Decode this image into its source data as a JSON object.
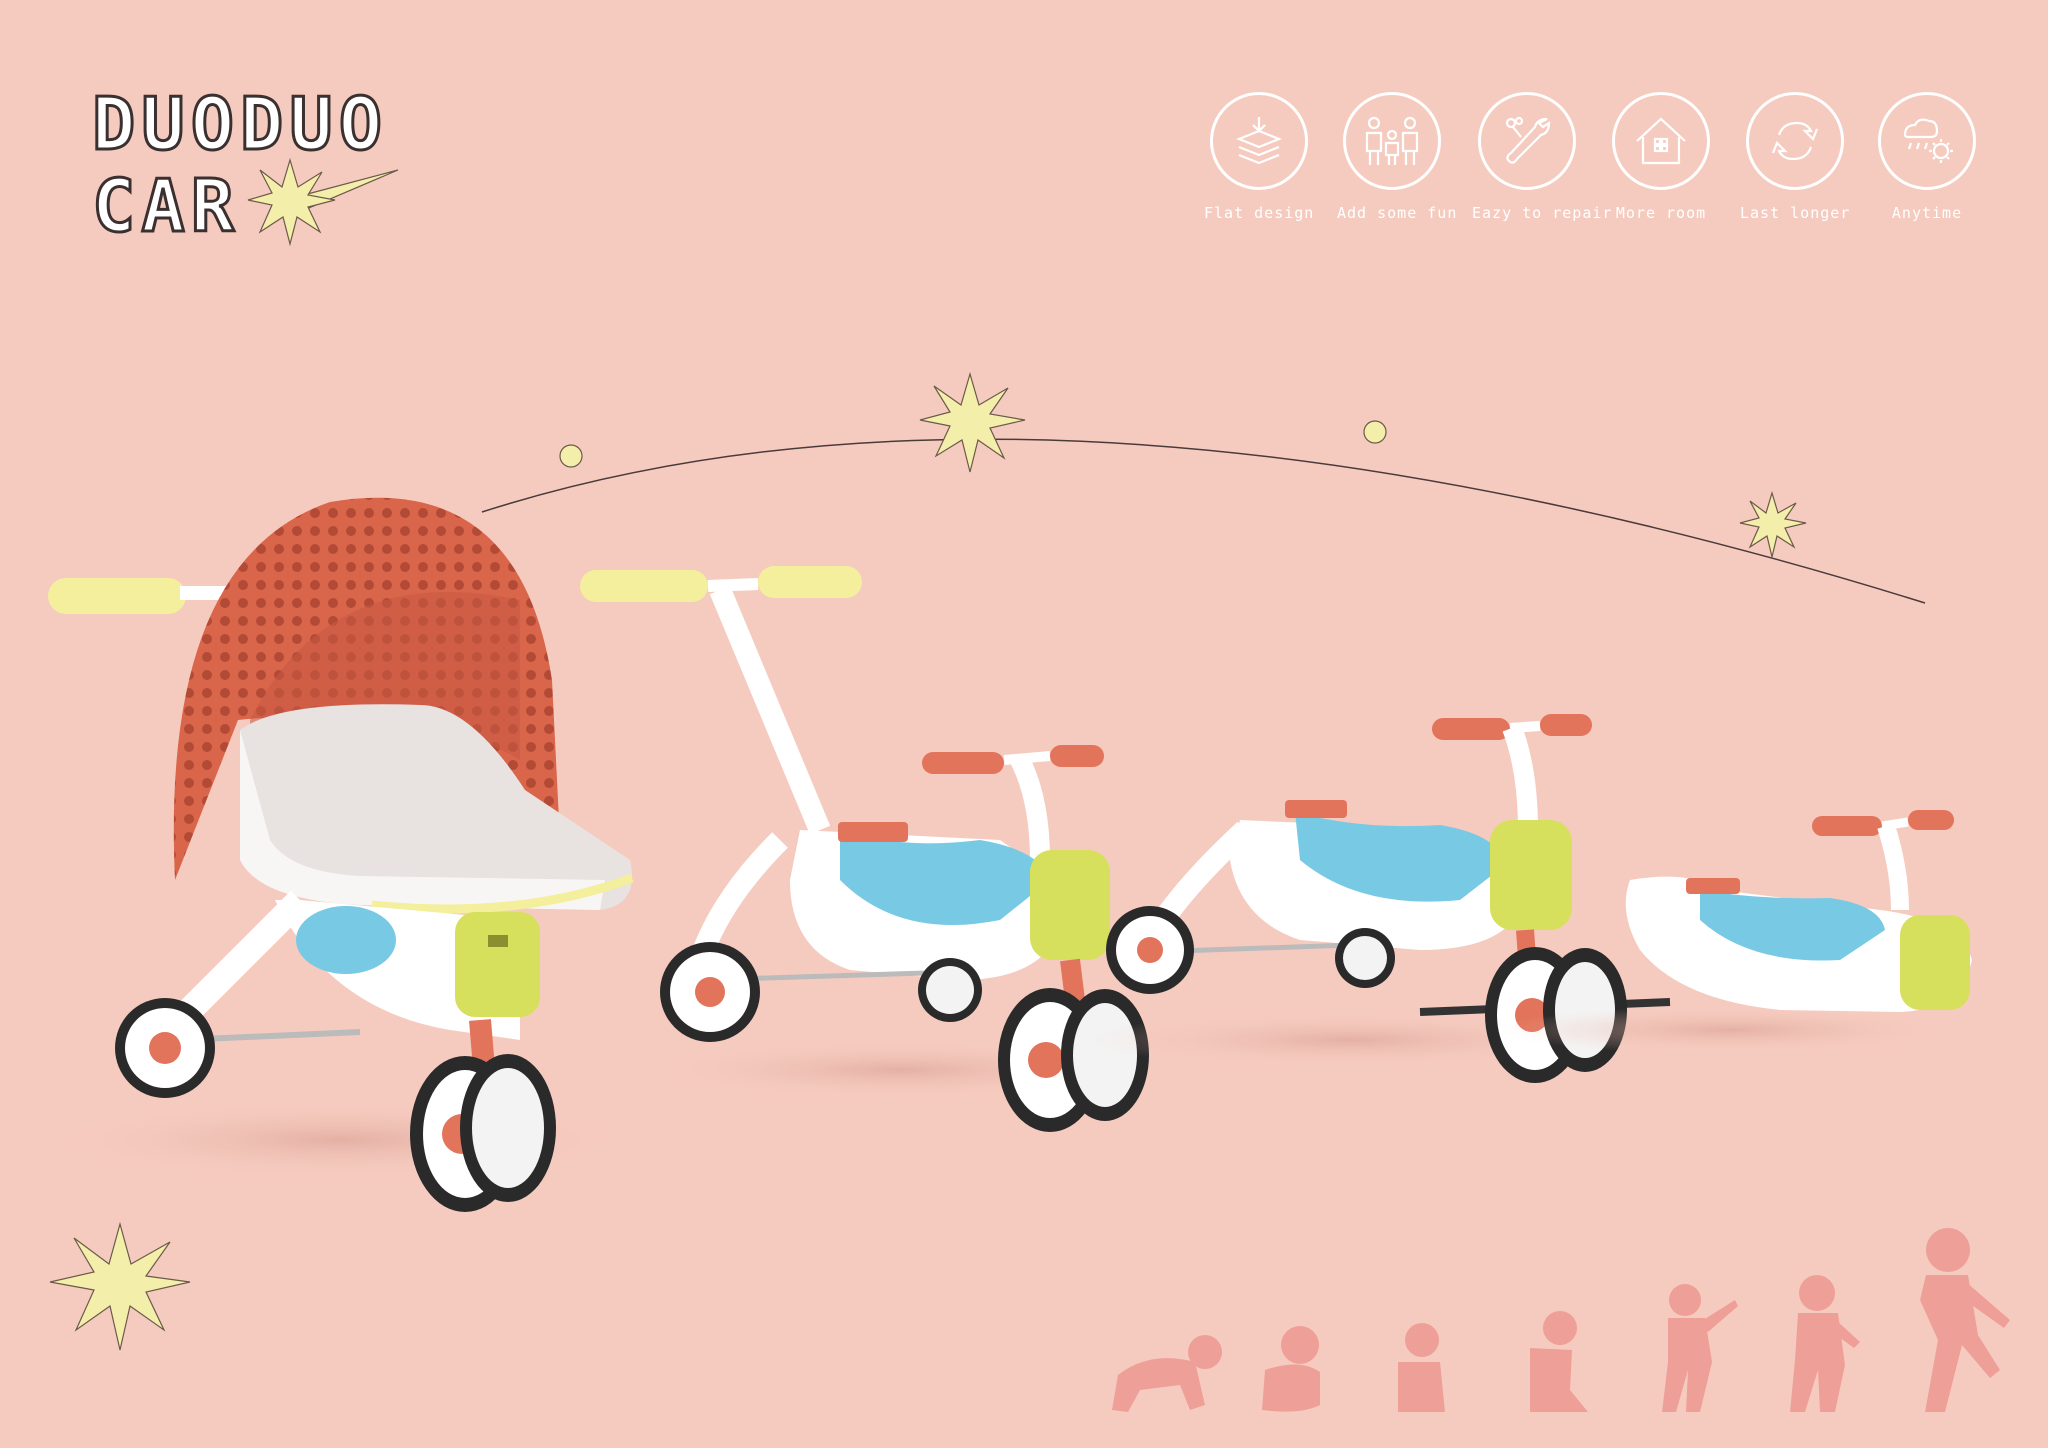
{
  "logo": {
    "line1": "DUODUO",
    "line2": "CAR"
  },
  "features": [
    {
      "label": "Flat design",
      "icon": "layers-icon"
    },
    {
      "label": "Add some fun",
      "icon": "family-icon"
    },
    {
      "label": "Eazy to repair",
      "icon": "wrench-icon"
    },
    {
      "label": "More  room",
      "icon": "house-icon"
    },
    {
      "label": "Last longer",
      "icon": "cycle-arrows-icon"
    },
    {
      "label": "Anytime",
      "icon": "weather-icon"
    }
  ],
  "colors": {
    "background": "#f6cbbf",
    "canopy": "#d9654a",
    "seat_blue": "#78c9e4",
    "handle_yellow": "#f3ef9c",
    "body_lime": "#d7e05c",
    "accent_coral": "#e2745c",
    "silhouette": "#ee9f98",
    "star": "#f4eeab"
  }
}
